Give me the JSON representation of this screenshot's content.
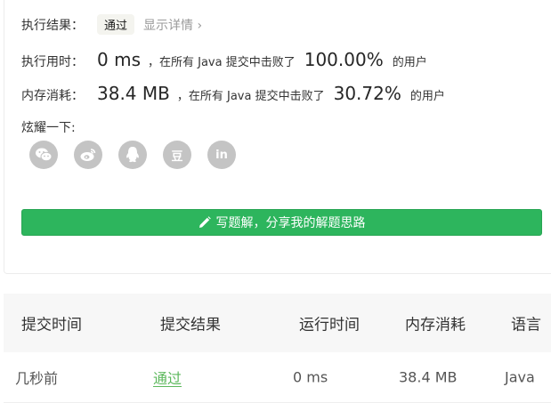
{
  "result": {
    "label": "执行结果：",
    "status": "通过",
    "detail_link": "显示详情 ›"
  },
  "runtime": {
    "label": "执行用时：",
    "value": "0 ms",
    "text_before": "，在所有 Java 提交中击败了",
    "percent": "100.00%",
    "text_after": "的用户"
  },
  "memory": {
    "label": "内存消耗：",
    "value": "38.4 MB",
    "text_before": "，在所有 Java 提交中击败了",
    "percent": "30.72%",
    "text_after": "的用户"
  },
  "share": {
    "label": "炫耀一下:",
    "icons": [
      "wechat-icon",
      "weibo-icon",
      "qq-icon",
      "douban-icon",
      "linkedin-icon"
    ],
    "douban_glyph": "豆",
    "linkedin_glyph": "in"
  },
  "solution_button": {
    "label": "写题解，分享我的解题思路",
    "icon": "pencil-icon",
    "color": "#2db55d"
  },
  "submissions": {
    "headers": [
      "提交时间",
      "提交结果",
      "运行时间",
      "内存消耗",
      "语言"
    ],
    "rows": [
      [
        "几秒前",
        "通过",
        "0 ms",
        "38.4 MB",
        "Java"
      ]
    ],
    "pass_color": "#5cb85c"
  }
}
